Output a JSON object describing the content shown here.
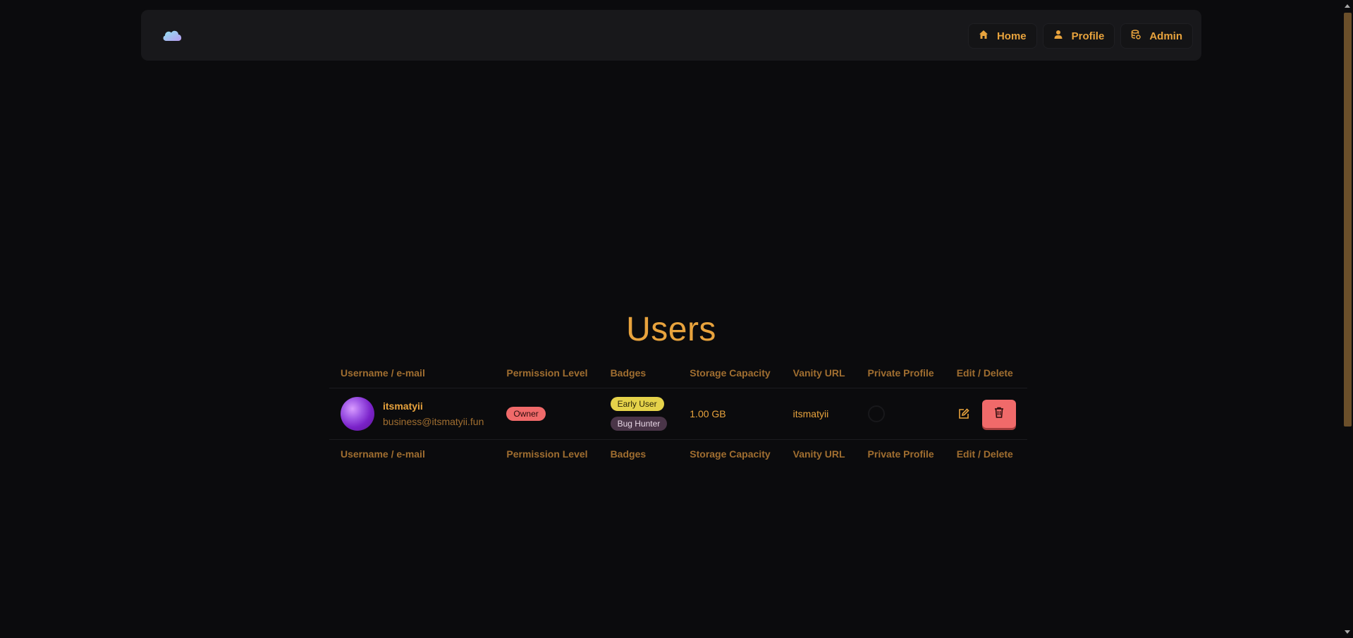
{
  "nav": {
    "logo": "cloud-logo",
    "links": [
      {
        "label": "Home",
        "icon": "home-icon"
      },
      {
        "label": "Profile",
        "icon": "user-icon"
      },
      {
        "label": "Admin",
        "icon": "database-icon"
      }
    ]
  },
  "page": {
    "title": "Users"
  },
  "table": {
    "headers": [
      "Username / e-mail",
      "Permission Level",
      "Badges",
      "Storage Capacity",
      "Vanity URL",
      "Private Profile",
      "Edit / Delete"
    ],
    "rows": [
      {
        "username": "itsmatyii",
        "email": "business@itsmatyii.fun",
        "permission": "Owner",
        "badges": [
          "Early User",
          "Bug Hunter"
        ],
        "storage": "1.00 GB",
        "vanity": "itsmatyii",
        "private": false
      }
    ]
  },
  "colors": {
    "accent": "#e8a33d",
    "muted": "#a06e30",
    "background": "#0b0b0d",
    "navbar": "#18181b",
    "danger": "#f06a6a",
    "badge_early": "#e5d24a",
    "badge_bug": "#4a3548"
  }
}
